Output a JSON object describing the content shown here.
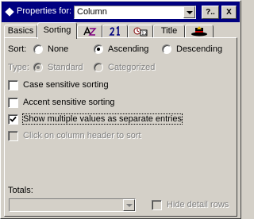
{
  "header": {
    "title": "Properties for:",
    "selected_item": "Column",
    "icon": "diamond-icon",
    "buttons": {
      "help": "?..",
      "close": "X"
    }
  },
  "tabs": [
    {
      "label": "Basics",
      "icon": ""
    },
    {
      "label": "Sorting",
      "icon": "",
      "active": true
    },
    {
      "label": "",
      "icon": "font-az-icon"
    },
    {
      "label": "",
      "icon": "alignment-21-icon"
    },
    {
      "label": "",
      "icon": "number-format-icon"
    },
    {
      "label": "Title",
      "icon": ""
    },
    {
      "label": "",
      "icon": "hat-icon"
    }
  ],
  "sort": {
    "label": "Sort:",
    "options": [
      "None",
      "Ascending",
      "Descending"
    ],
    "selected": "Ascending"
  },
  "type": {
    "label": "Type:",
    "options": [
      "Standard",
      "Categorized"
    ],
    "selected": "Standard",
    "enabled": false
  },
  "checkboxes": [
    {
      "label": "Case sensitive sorting",
      "checked": false,
      "enabled": true
    },
    {
      "label": "Accent sensitive sorting",
      "checked": false,
      "enabled": true
    },
    {
      "label": "Show multiple values as separate entries",
      "checked": true,
      "enabled": true
    },
    {
      "label": "Click on column header to sort",
      "checked": false,
      "enabled": false
    }
  ],
  "totals": {
    "label": "Totals:",
    "value": "",
    "hide_detail_label": "Hide detail rows",
    "hide_detail_checked": false,
    "enabled": false
  },
  "colors": {
    "titlebar": "#000080",
    "face": "#d4d0c8"
  }
}
